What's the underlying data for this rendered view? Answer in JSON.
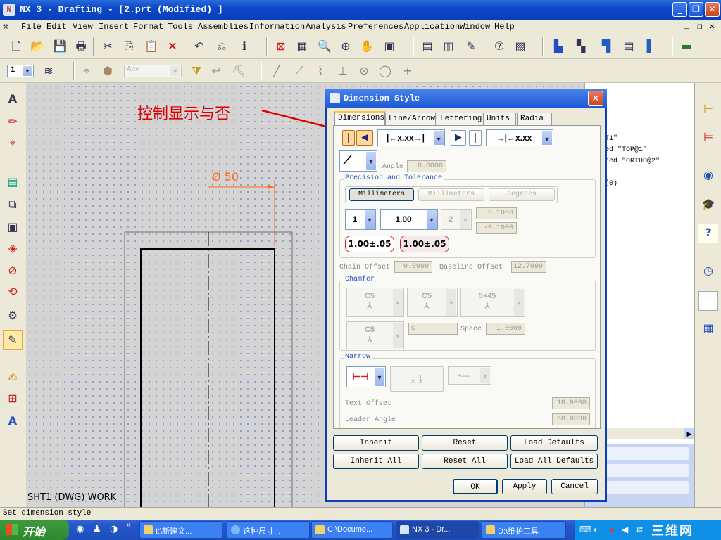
{
  "window": {
    "title": "NX 3 - Drafting - [2.prt (Modified) ]"
  },
  "menu": [
    "File",
    "Edit",
    "View",
    "Insert",
    "Format",
    "Tools",
    "Assemblies",
    "Information",
    "Analysis",
    "Preferences",
    "Application",
    "Window",
    "Help"
  ],
  "toolbar2": {
    "layer_value": "1",
    "filter_value": "Any"
  },
  "annotation": {
    "text": "控制显示与否",
    "color": "#e00000"
  },
  "drawing": {
    "dim_text": "Ø 50",
    "sheet_label": "SHT1 (DWG) WORK"
  },
  "rightpanel": {
    "lines": [
      "T1\"",
      "ed \"TOP@1\"",
      "ted \"ORTHO@2\"",
      "(0)"
    ]
  },
  "dialog": {
    "title": "Dimension Style",
    "tabs": [
      "Dimensions",
      "Line/Arrow",
      "Lettering",
      "Units",
      "Radial"
    ],
    "dim_placement": "|←x.xx→|",
    "dim_text_placement": "→|←x.xx",
    "angle_label": "Angle",
    "angle_value": "0.0000",
    "precision_group": "Precision and Tolerance",
    "unit_buttons": [
      "Millimeters",
      "Millimeters",
      "Degrees"
    ],
    "precision_value": "1",
    "tolerance_type": "1.00",
    "tol_precision": "2",
    "upper_tol": "0.1000",
    "lower_tol": "-0.1000",
    "tol_buttons": [
      "1.00±.05",
      "1.00±.05"
    ],
    "chain_offset_label": "Chain Offset",
    "chain_offset_value": "0.0000",
    "baseline_offset_label": "Baseline Offset",
    "baseline_offset_value": "12.7000",
    "chamfer_group": "Chamfer",
    "chamfer_styles": [
      "C5",
      "C5",
      "5×45",
      "C5"
    ],
    "chamfer_text": "C",
    "space_label": "Space",
    "space_value": "1.0000",
    "narrow_group": "Narrow",
    "text_offset_label": "Text Offset",
    "text_offset_value": "10.0000",
    "leader_angle_label": "Leader Angle",
    "leader_angle_value": "60.0000",
    "buttons": [
      "Inherit",
      "Reset",
      "Load Defaults",
      "Inherit All",
      "Reset All",
      "Load All Defaults"
    ],
    "ok": "OK",
    "apply": "Apply",
    "cancel": "Cancel"
  },
  "status": "Set dimension style",
  "taskbar": {
    "start": "开始",
    "tasks": [
      "I:\\新建文...",
      "这种尺寸...",
      "C:\\Docume...",
      "NX 3 - Dr...",
      "D:\\维护工具"
    ]
  }
}
